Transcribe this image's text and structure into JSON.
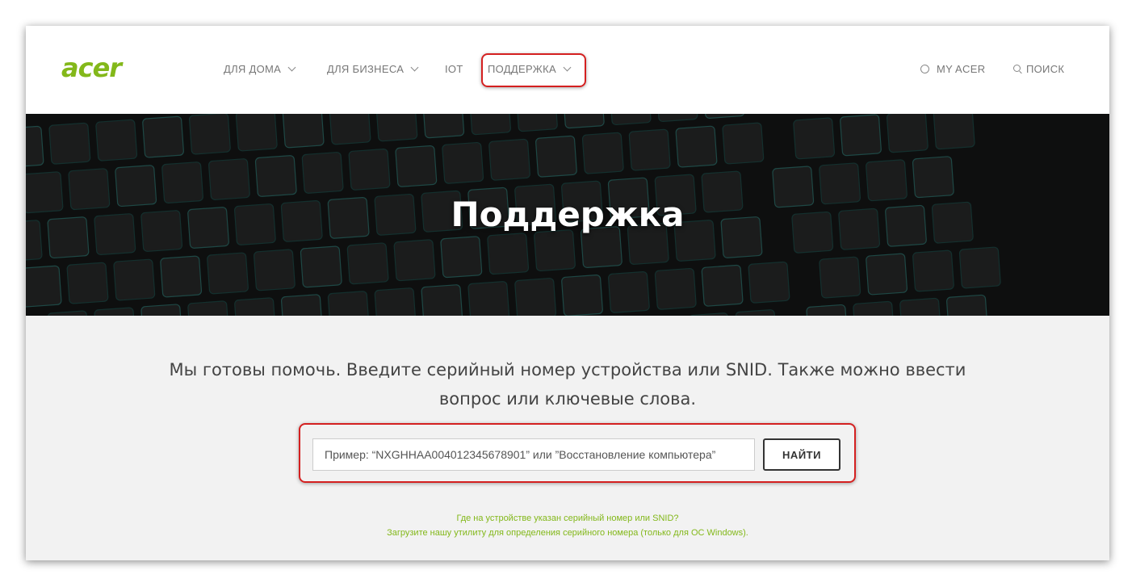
{
  "header": {
    "logo": "acer",
    "nav": [
      {
        "label": "ДЛЯ ДОМА"
      },
      {
        "label": "ДЛЯ БИЗНЕСА"
      },
      {
        "label": "IOT"
      },
      {
        "label": "ПОДДЕРЖКА"
      }
    ],
    "my_acer": "MY ACER",
    "search": "ПОИСК"
  },
  "hero": {
    "title": "Поддержка"
  },
  "main": {
    "intro_line1": "Мы готовы помочь. Введите серийный номер устройства или SNID. Также можно ввести",
    "intro_line2": "вопрос или ключевые слова.",
    "search_placeholder": "Пример: “NXGHHAA004012345678901” или ”Восстановление компьютера”",
    "search_button": "НАЙТИ",
    "help_link_1": "Где на устройстве указан серийный номер или SNID?",
    "help_link_2": "Загрузите нашу утилиту для определения серийного номера (только для ОС Windows)."
  },
  "colors": {
    "brand_green": "#83b81a",
    "highlight_red": "#d42020",
    "hero_bg": "#161717"
  }
}
